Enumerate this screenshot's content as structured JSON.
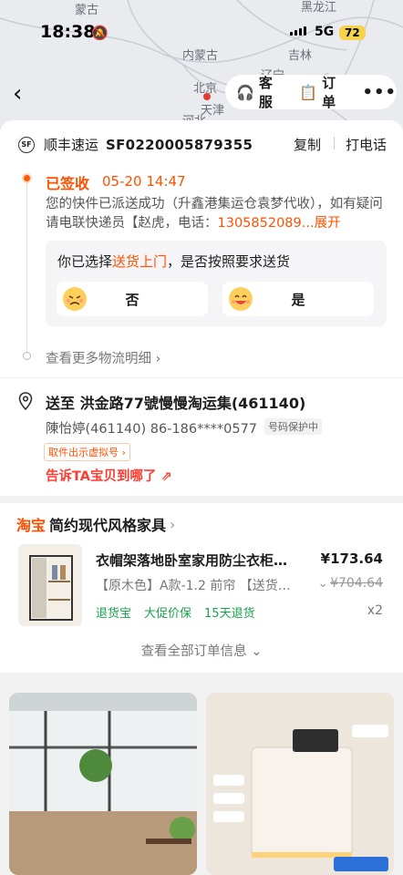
{
  "status_bar": {
    "time": "18:38",
    "network": "5G",
    "battery": "72"
  },
  "map": {
    "labels": [
      "蒙古",
      "黑龙江",
      "内蒙古",
      "吉林",
      "北京",
      "辽宁",
      "天津",
      "河北"
    ]
  },
  "nav": {
    "back_icon": "chevron-left-icon",
    "service_label": "客服",
    "order_label": "订单",
    "more_label": "•••"
  },
  "shipment": {
    "carrier_logo": "SF",
    "carrier": "顺丰速运",
    "tracking_no": "SF0220005879355",
    "copy_label": "复制",
    "call_label": "打电话",
    "status": "已签收",
    "status_time": "05-20 14:47",
    "desc_prefix": "您的快件已派送成功（升鑫港集运仓袁梦代收），如有疑问请电联快递员【赵虎，电话：",
    "desc_phone": "1305852089...",
    "desc_expand": "展开",
    "ask_prefix": "你已选择",
    "ask_highlight": "送货上门",
    "ask_suffix": "，是否按照要求送货",
    "option_no": "否",
    "option_yes": "是",
    "more_logistics": "查看更多物流明细 ›"
  },
  "address": {
    "to": "送至  洪金路77號慢慢淘运集(461140)",
    "contact": "陳怡婷(461140)  86-186****0577",
    "privacy": "号码保护中",
    "pickup": "取件出示虚拟号 ›",
    "tell": "告诉TA宝贝到哪了 ⇗"
  },
  "shop": {
    "platform": "淘宝",
    "name": "简约现代风格家具",
    "product": {
      "title": "衣帽架落地卧室家用防尘衣柜…",
      "price": "¥173.64",
      "sku": "【原木色】A款-1.2 前帘 【送货…",
      "sku_caret": "⌄",
      "original_price": "¥704.64",
      "tags": [
        "退货宝",
        "大促价保",
        "15天退货"
      ],
      "qty": "x2"
    },
    "view_all": "查看全部订单信息 ⌄"
  },
  "colors": {
    "accent": "#ff5000",
    "green": "#1aa24a"
  }
}
